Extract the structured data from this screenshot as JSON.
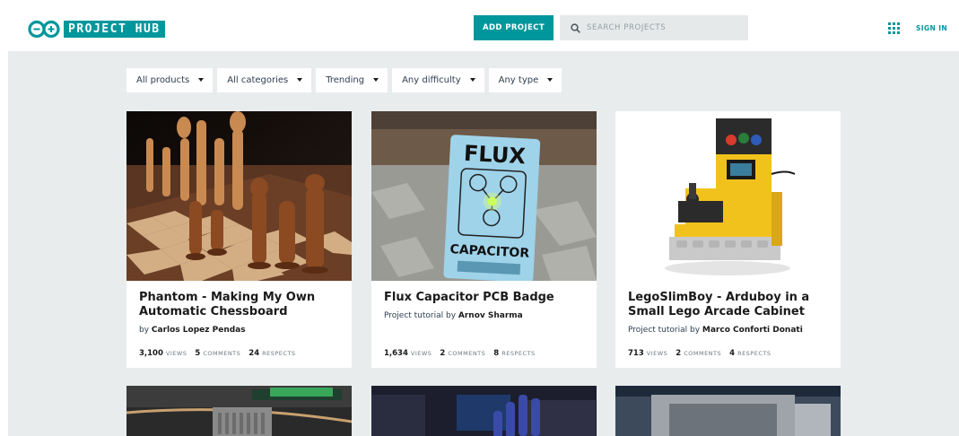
{
  "header": {
    "logo_text": "PROJECT HUB",
    "add_project_label": "ADD PROJECT",
    "search_placeholder": "SEARCH PROJECTS",
    "sign_in_label": "SIGN IN"
  },
  "filters": [
    {
      "label": "All products"
    },
    {
      "label": "All categories"
    },
    {
      "label": "Trending"
    },
    {
      "label": "Any difficulty"
    },
    {
      "label": "Any type"
    }
  ],
  "cards": [
    {
      "title": "Phantom - Making My Own Automatic Chessboard",
      "byline_prefix": "by ",
      "author": "Carlos Lopez Pendas",
      "views": "3,100",
      "comments": "5",
      "respects": "24"
    },
    {
      "title": "Flux Capacitor PCB Badge",
      "byline_prefix": "Project tutorial by ",
      "author": "Arnov Sharma",
      "views": "1,634",
      "comments": "2",
      "respects": "8",
      "image_text_top": "FLUX",
      "image_text_bottom": "CAPACITOR"
    },
    {
      "title": "LegoSlimBoy - Arduboy in a Small Lego Arcade Cabinet",
      "byline_prefix": "Project tutorial by ",
      "author": "Marco Conforti Donati",
      "views": "713",
      "comments": "2",
      "respects": "4"
    }
  ],
  "stat_labels": {
    "views": "VIEWS",
    "comments": "COMMENTS",
    "respects": "RESPECTS"
  },
  "colors": {
    "brand_teal": "#00979c",
    "page_background": "#e8eced",
    "search_background": "#e6e9ea"
  },
  "icons": [
    "arduino-logo-icon",
    "search-icon",
    "apps-grid-icon",
    "dropdown-caret-icon"
  ]
}
